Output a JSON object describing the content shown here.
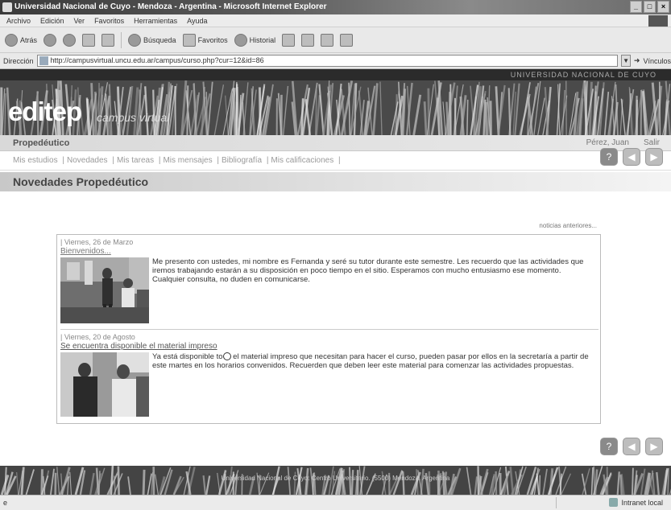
{
  "browser": {
    "window_title": "Universidad Nacional de Cuyo - Mendoza - Argentina - Microsoft Internet Explorer",
    "menu": [
      "Archivo",
      "Edición",
      "Ver",
      "Favoritos",
      "Herramientas",
      "Ayuda"
    ],
    "toolbar": {
      "back_label": "Atrás",
      "search_label": "Búsqueda",
      "favorites_label": "Favoritos",
      "history_label": "Historial"
    },
    "address_label": "Dirección",
    "address_value": "http://campusvirtual.uncu.edu.ar/campus/curso.php?cur=12&id=86",
    "go_label": "Vínculos",
    "status_left": "",
    "status_zone": "Intranet local"
  },
  "site": {
    "top_strip": "UNIVERSIDAD NACIONAL DE CUYO",
    "logo": "editep",
    "logo_sub": "campus virtual",
    "course": "Propedéutico",
    "user": "Pérez, Juan",
    "logout": "Salir",
    "nav": [
      "Mis estudios",
      "Novedades",
      "Mis tareas",
      "Mis mensajes",
      "Bibliografía",
      "Mis calificaciones"
    ],
    "section_title": "Novedades Propedéutico",
    "older_news": "noticias anteriores...",
    "footer": "Universidad Nacional de Cuyo. Centro Universitario. (5500) Mendoza. Argentina"
  },
  "news": [
    {
      "date": "| Viernes, 26 de Marzo",
      "title": "Bienvenidos...",
      "text": "Me presento con ustedes, mi nombre es Fernanda y seré su tutor durante este semestre. Les recuerdo que las actividades que iremos trabajando estarán a su disposición en poco tiempo en el sitio. Esperamos con mucho entusiasmo ese momento. Cualquier consulta, no duden en comunicarse."
    },
    {
      "date": "| Viernes, 20 de Agosto",
      "title": "Se encuentra disponible el material impreso",
      "text_a": "Ya está disponible to",
      "text_b": "el material impreso que necesitan para hacer el curso, pueden pasar por ellos en la secretaría a partir de este martes en los horarios convenidos. Recuerden que deben leer este material para comenzar las actividades propuestas."
    }
  ]
}
